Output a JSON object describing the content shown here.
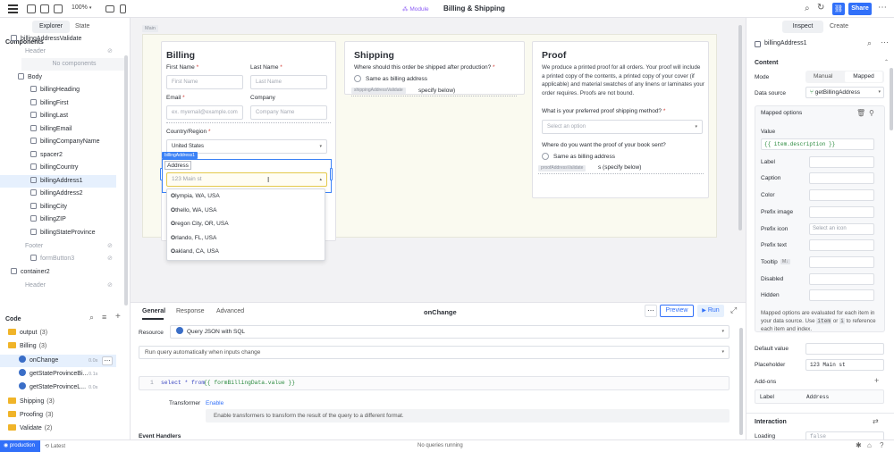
{
  "topbar": {
    "zoom": "100%",
    "module_badge": "Module",
    "title": "Billing & Shipping",
    "share_label": "Share"
  },
  "left": {
    "tabs": [
      "Explorer",
      "State"
    ],
    "components_heading": "Components",
    "tree": [
      {
        "label": "billingAddressValidate",
        "icon": "container-icon"
      },
      {
        "label": "Header",
        "icon": "none",
        "muted": true
      },
      {
        "label": "No components",
        "icon": "none",
        "muted": true
      },
      {
        "label": "Body",
        "icon": "bracket-icon"
      },
      {
        "label": "billingHeading",
        "icon": "text-icon"
      },
      {
        "label": "billingFirst",
        "icon": "input-icon"
      },
      {
        "label": "billingLast",
        "icon": "input-icon"
      },
      {
        "label": "billingEmail",
        "icon": "input-icon"
      },
      {
        "label": "billingCompanyName",
        "icon": "input-icon"
      },
      {
        "label": "spacer2",
        "icon": "spacer-icon"
      },
      {
        "label": "billingCountry",
        "icon": "select-icon"
      },
      {
        "label": "billingAddress1",
        "icon": "select-icon",
        "selected": true
      },
      {
        "label": "billingAddress2",
        "icon": "input-icon"
      },
      {
        "label": "billingCity",
        "icon": "input-icon"
      },
      {
        "label": "billingZIP",
        "icon": "input-icon"
      },
      {
        "label": "billingStateProvince",
        "icon": "select-icon"
      },
      {
        "label": "Footer",
        "icon": "none",
        "muted": true
      },
      {
        "label": "formButton3",
        "icon": "button-icon",
        "muted": true
      },
      {
        "label": "container2",
        "icon": "container-icon"
      },
      {
        "label": "Header",
        "icon": "none",
        "muted": true
      }
    ],
    "code_heading": "Code",
    "code_items": [
      {
        "label": "output",
        "count": "(3)",
        "type": "folder"
      },
      {
        "label": "Billing",
        "count": "(3)",
        "type": "folder"
      },
      {
        "label": "onChange",
        "count": "0.0s",
        "type": "query",
        "selected": true
      },
      {
        "label": "getStateProvinceBi...",
        "count": "0.1s",
        "type": "query"
      },
      {
        "label": "getStateProvinceL...",
        "count": "0.0s",
        "type": "query"
      },
      {
        "label": "Shipping",
        "count": "(3)",
        "type": "folder"
      },
      {
        "label": "Proofing",
        "count": "(3)",
        "type": "folder"
      },
      {
        "label": "Validate",
        "count": "(2)",
        "type": "folder"
      }
    ]
  },
  "canvas": {
    "main_tag": "Main",
    "billing": {
      "heading": "Billing",
      "first_label": "First Name",
      "first_ph": "First Name",
      "last_label": "Last Name",
      "last_ph": "Last Name",
      "email_label": "Email",
      "email_ph": "ex. myemail@example.com",
      "company_label": "Company",
      "company_ph": "Company Name",
      "country_label": "Country/Region",
      "country_value": "United States",
      "selected_tag": "billingAddress1",
      "address_label": "Address",
      "address_value": "123 Main st",
      "options": [
        {
          "first": "O",
          "rest": "lympia, WA, USA"
        },
        {
          "first": "O",
          "rest": "thello, WA, USA"
        },
        {
          "first": "O",
          "rest": "regon City, OR, USA"
        },
        {
          "first": "O",
          "rest": "rlando, FL, USA"
        },
        {
          "first": "O",
          "rest": "akland, CA, USA"
        }
      ]
    },
    "shipping": {
      "heading": "Shipping",
      "question": "Where should this order be shipped after production?",
      "radio_label": "Same as billing address",
      "tag": "shippingAddressValidate",
      "tail": "specify below)"
    },
    "proof": {
      "heading": "Proof",
      "body": "We produce a printed proof for all orders. Your proof will include a printed copy of the contents, a printed copy of your cover (if applicable) and material swatches of any linens or laminates your order requires. Proofs are not bound.",
      "method_q": "What is your preferred proof shipping method?",
      "method_ph": "Select an option",
      "sent_q": "Where do you want the proof of your book sent?",
      "radio_label": "Same as billing address",
      "tag": "proofAddressValidate",
      "tail": "s (specify below)"
    }
  },
  "bottom": {
    "tabs": [
      "General",
      "Response",
      "Advanced"
    ],
    "query_name": "onChange",
    "preview_label": "Preview",
    "run_label": "Run",
    "resource_label": "Resource",
    "resource_value": "Query JSON with SQL",
    "trigger_value": "Run query automatically when inputs change",
    "line_no": "1",
    "code_keyword": "select * from",
    "code_expr": "{{ formBillingData.value }}",
    "transformer_label": "Transformer",
    "transformer_enable": "Enable",
    "transformer_hint": "Enable transformers to transform the result of the query to a different format.",
    "event_handlers": "Event Handlers"
  },
  "right": {
    "tabs": [
      "Inspect",
      "Create"
    ],
    "component_name": "billingAddress1",
    "content_heading": "Content",
    "mode_label": "Mode",
    "mode_options": [
      "Manual",
      "Mapped"
    ],
    "data_source_label": "Data source",
    "data_source_value": "getBillingAddress",
    "mapped_heading": "Mapped options",
    "value_label": "Value",
    "value_expr": "{{ item.description }}",
    "props": [
      "Label",
      "Caption",
      "Color",
      "Prefix image",
      "Prefix icon",
      "Prefix text",
      "Tooltip",
      "Disabled",
      "Hidden"
    ],
    "prefix_icon_ph": "Select an icon",
    "tooltip_badge": "M↓",
    "mapped_note": "Mapped options are evaluated for each item in your data source. Use",
    "mapped_note_item": "item",
    "mapped_note_or": "or",
    "mapped_note_i": "i",
    "mapped_note_end": "to reference each item and index.",
    "default_value_label": "Default value",
    "placeholder_label": "Placeholder",
    "placeholder_value": "123 Main st",
    "addons_label": "Add-ons",
    "addon_key": "Label",
    "addon_value": "Address",
    "interaction_heading": "Interaction",
    "loading_label": "Loading",
    "loading_value": "false"
  },
  "status": {
    "env": "production",
    "branch": "Latest",
    "queries": "No queries running"
  },
  "colors": {
    "accent": "#3170f9",
    "module": "#8c5cf5",
    "selected_bg": "#e6f0fd",
    "tree_highlight": "#dbe7fb"
  }
}
